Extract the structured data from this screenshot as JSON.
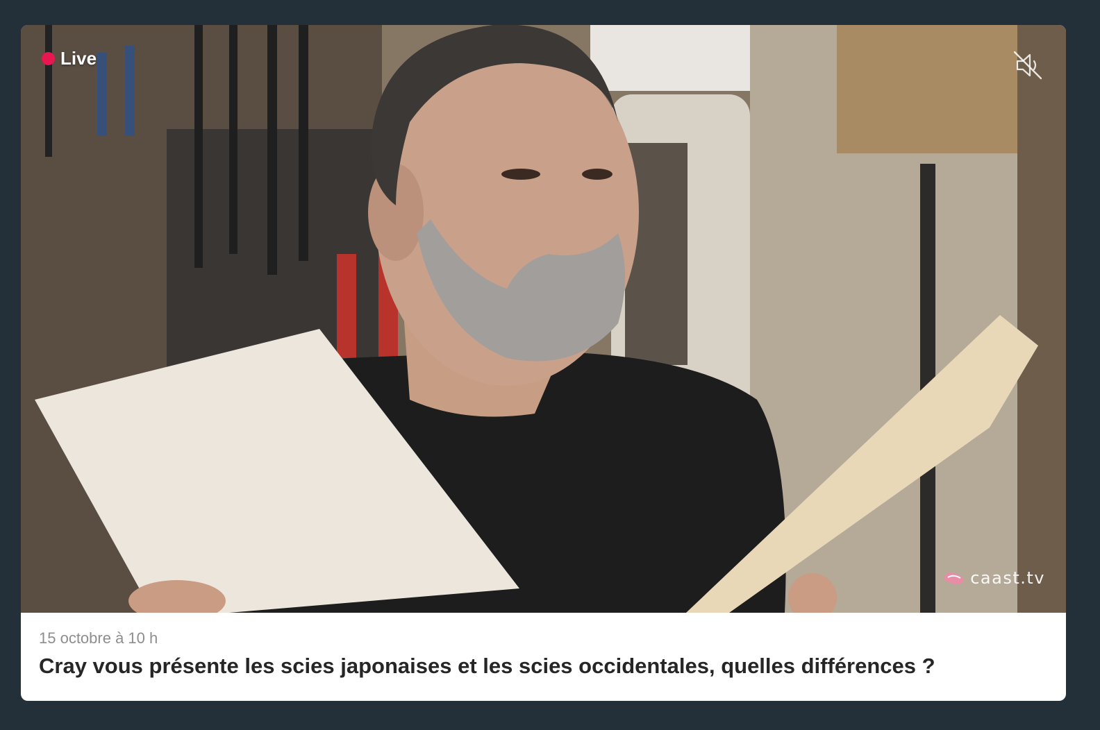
{
  "video": {
    "live_label": "Live",
    "watermark_text": "caast.tv",
    "mute_icon": "volume-muted-icon",
    "live_color": "#e8174f"
  },
  "event": {
    "date": "15 octobre à 10 h",
    "title": "Cray vous présente les scies japonaises et les scies occidentales, quelles différences ?"
  },
  "colors": {
    "page_background": "#243039",
    "card_background": "#ffffff",
    "date_text": "#8d8d8d",
    "title_text": "#262626"
  }
}
